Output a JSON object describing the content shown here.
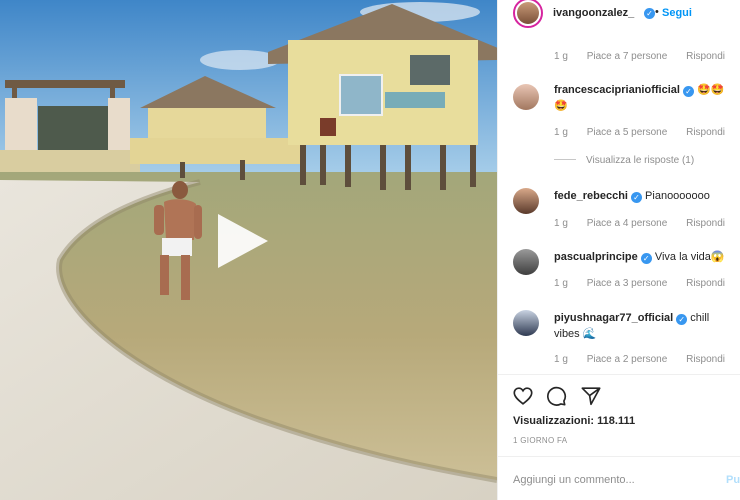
{
  "post": {
    "author": "ivangoonzalez_",
    "follow_label": "Segui",
    "separator": "•",
    "verified_glyph": "✓",
    "views_label": "Visualizzazioni:",
    "views_count": "118.111",
    "posted_ago": "1 GIORNO FA",
    "comment_placeholder": "Aggiungi un commento...",
    "post_label": "Pu"
  },
  "comments": [
    {
      "username": "",
      "text": "",
      "age": "1 g",
      "likes": "Piace a 7 persone",
      "reply": "Rispondi"
    },
    {
      "username": "francescaciprianiofficial",
      "text": "🤩🤩🤩",
      "age": "1 g",
      "likes": "Piace a 5 persone",
      "reply": "Rispondi",
      "view_replies": "Visualizza le risposte (1)"
    },
    {
      "username": "fede_rebecchi",
      "text": "Pianooooooo",
      "age": "1 g",
      "likes": "Piace a 4 persone",
      "reply": "Rispondi"
    },
    {
      "username": "pascualprincipe",
      "text": "Viva la vida😱",
      "age": "1 g",
      "likes": "Piace a 3 persone",
      "reply": "Rispondi"
    },
    {
      "username": "piyushnagar77_official",
      "text": "chill vibes 🌊",
      "age": "1 g",
      "likes": "Piace a 2 persone",
      "reply": "Rispondi"
    }
  ],
  "icons": [
    "play-icon",
    "heart-icon",
    "comment-icon",
    "share-icon",
    "verified-icon"
  ],
  "colors": {
    "link_blue": "#0095f6",
    "verified_blue": "#3897f0",
    "muted_text": "#8e8e8e",
    "post_disabled": "#b2dffc"
  }
}
